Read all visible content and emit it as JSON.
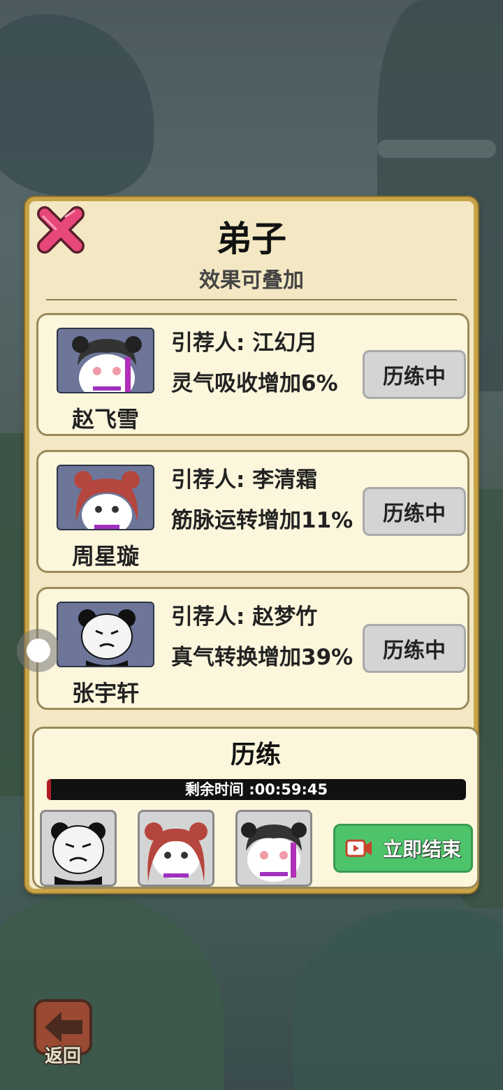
{
  "dialog": {
    "title": "弟子",
    "subtitle": "效果可叠加"
  },
  "disciples": [
    {
      "name": "赵飞雪",
      "recommender": "引荐人: 江幻月",
      "effect": "灵气吸收增加6%",
      "status": "历练中",
      "avatar": "black-hair-girl-avatar"
    },
    {
      "name": "周星璇",
      "recommender": "引荐人: 李清霜",
      "effect": "筋脉运转增加11%",
      "status": "历练中",
      "avatar": "red-hair-girl-avatar"
    },
    {
      "name": "张宇轩",
      "recommender": "引荐人: 赵梦竹",
      "effect": "真气转换增加39%",
      "status": "历练中",
      "avatar": "panda-face-avatar"
    }
  ],
  "training": {
    "title": "历练",
    "timer_text": "剩余时间 :00:59:45",
    "progress": 0.01,
    "end_button_label": "立即结束"
  },
  "back_label": "返回",
  "colors": {
    "panel": "#f3e8c3",
    "panel_border": "#c7a449",
    "end_button": "#4ec46a",
    "status_button": "#d4d4d4",
    "close_x": "#e8477a"
  }
}
